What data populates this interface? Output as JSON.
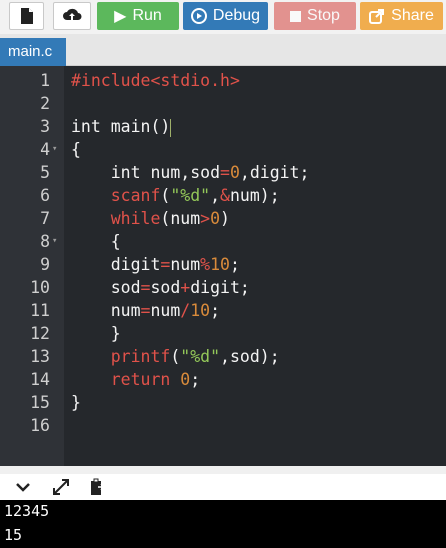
{
  "toolbar": {
    "new_file_icon": "file-icon",
    "upload_icon": "upload-icon",
    "run_label": "Run",
    "debug_label": "Debug",
    "stop_label": "Stop",
    "share_label": "Share",
    "colors": {
      "run": "#5cb85c",
      "debug": "#337ab7",
      "stop": "#d9534f",
      "share": "#f0ad4e"
    }
  },
  "tabs": [
    {
      "label": "main.c",
      "active": true
    }
  ],
  "editor": {
    "line_numbers": [
      "1",
      "2",
      "3",
      "4",
      "5",
      "6",
      "7",
      "8",
      "9",
      "10",
      "11",
      "12",
      "13",
      "14",
      "15",
      "16"
    ],
    "lines": [
      "#include<stdio.h>",
      "",
      "int main()",
      "{",
      "    int num,sod=0,digit;",
      "    scanf(\"%d\",&num);",
      "    while(num>0)",
      "    {",
      "    digit=num%10;",
      "    sod=sod+digit;",
      "    num=num/10;",
      "    }",
      "    printf(\"%d\",sod);",
      "    return 0;",
      "}",
      ""
    ],
    "fold_markers": [
      "4",
      "8"
    ]
  },
  "console": {
    "icons": [
      "chevron-down-icon",
      "expand-icon",
      "copy-paste-icon"
    ],
    "output_lines": [
      "12345",
      "15"
    ]
  }
}
